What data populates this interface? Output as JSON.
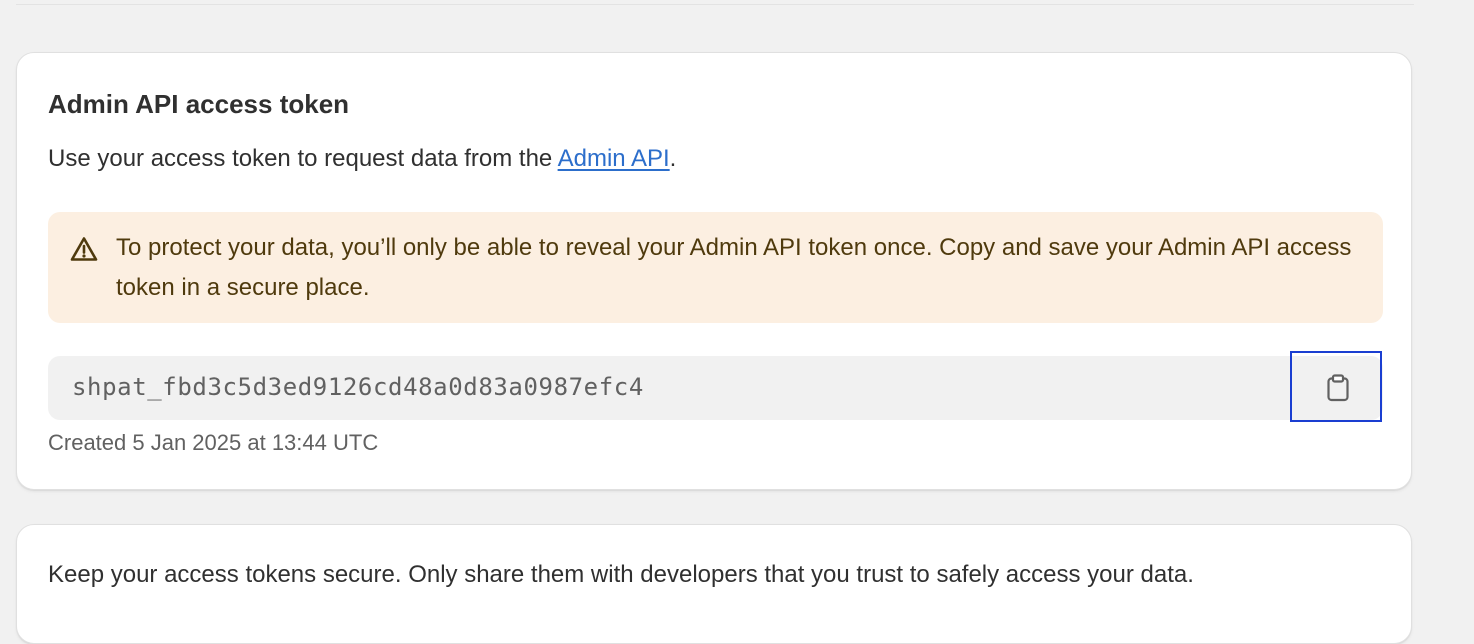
{
  "token_card": {
    "title": "Admin API access token",
    "description_prefix": "Use your access token to request data from the ",
    "description_link": "Admin API",
    "description_suffix": ".",
    "warning": {
      "icon": "warning-triangle-icon",
      "text": "To protect your data, you’ll only be able to reveal your Admin API token once. Copy and save your Admin API access token in a secure place."
    },
    "token_value": "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",
    "copy_icon": "clipboard-icon",
    "created_text": "Created 5 Jan 2025 at 13:44 UTC"
  },
  "secure_card": {
    "text": "Keep your access tokens secure. Only share them with developers that you trust to safely access your data."
  },
  "colors": {
    "page_background": "#f1f1f1",
    "card_background": "#ffffff",
    "warning_background": "#fcefe1",
    "warning_text": "#4f3a0d",
    "link": "#2c6ecb",
    "focus_outline": "#1a3ed1"
  }
}
